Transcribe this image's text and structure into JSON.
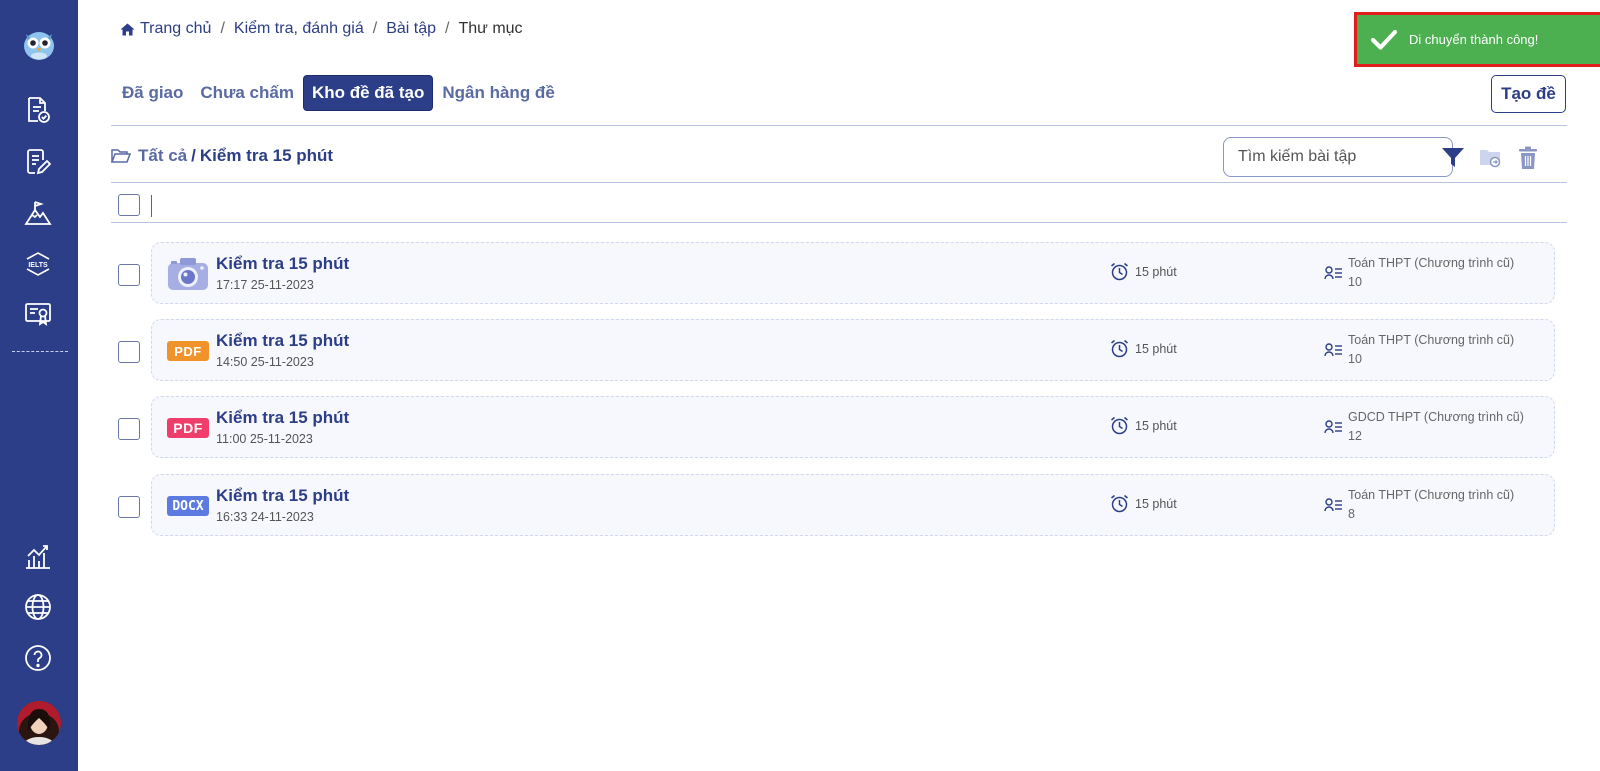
{
  "toast": {
    "message": "Di chuyển thành công!"
  },
  "breadcrumb": [
    "Trang chủ",
    "Kiểm tra, đánh giá",
    "Bài tập",
    "Thư mục"
  ],
  "tabs": [
    {
      "label": "Đã giao",
      "active": false
    },
    {
      "label": "Chưa chấm",
      "active": false
    },
    {
      "label": "Kho đề đã tạo",
      "active": true
    },
    {
      "label": "Ngân hàng đề",
      "active": false
    }
  ],
  "create_button": "Tạo đề",
  "folder_path": {
    "root": "Tất cả",
    "separator": "/",
    "current": "Kiểm tra 15 phút"
  },
  "search": {
    "placeholder": "Tìm kiếm bài tập",
    "value": ""
  },
  "colors": {
    "primary": "#2c3e87",
    "success": "#4caf50",
    "pdf_orange": "#f0932b",
    "pdf_red": "#ef3e6b",
    "docx_blue": "#5b7be0"
  },
  "items": [
    {
      "title": "Kiểm tra 15 phút",
      "date": "17:17 25-11-2023",
      "type": "camera-icon",
      "duration": "15 phút",
      "subject": "Toán THPT (Chương trình cũ) 10"
    },
    {
      "title": "Kiểm tra 15 phút",
      "date": "14:50 25-11-2023",
      "type": "pdf-orange-icon",
      "duration": "15 phút",
      "subject": "Toán THPT (Chương trình cũ) 10"
    },
    {
      "title": "Kiểm tra 15 phút",
      "date": "11:00 25-11-2023",
      "type": "pdf-red-icon",
      "duration": "15 phút",
      "subject": "GDCD THPT (Chương trình cũ) 12"
    },
    {
      "title": "Kiểm tra 15 phút",
      "date": "16:33 24-11-2023",
      "type": "docx-icon",
      "duration": "15 phút",
      "subject": "Toán THPT (Chương trình cũ) 8"
    }
  ],
  "file_badges": {
    "pdf": "PDF",
    "docx": "DOCX"
  },
  "sidebar_icon_text": {
    "ielts": "IELTS"
  }
}
